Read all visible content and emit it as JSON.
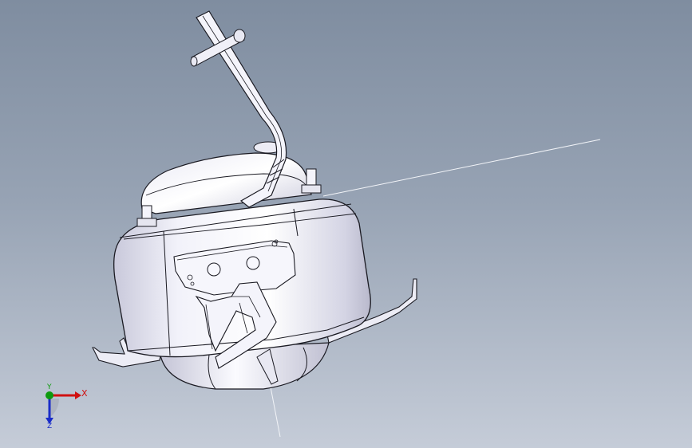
{
  "viewport": {
    "background_top": "#7f8da0",
    "background_bottom": "#c5ccd8",
    "part_color": "#f4f4fb",
    "edge_color": "#1a1a22"
  },
  "triad": {
    "x_label": "X",
    "y_label": "Y",
    "z_label": "Z",
    "x_color": "#d01010",
    "y_color": "#0d9a0d",
    "z_color": "#1a2cc8"
  }
}
